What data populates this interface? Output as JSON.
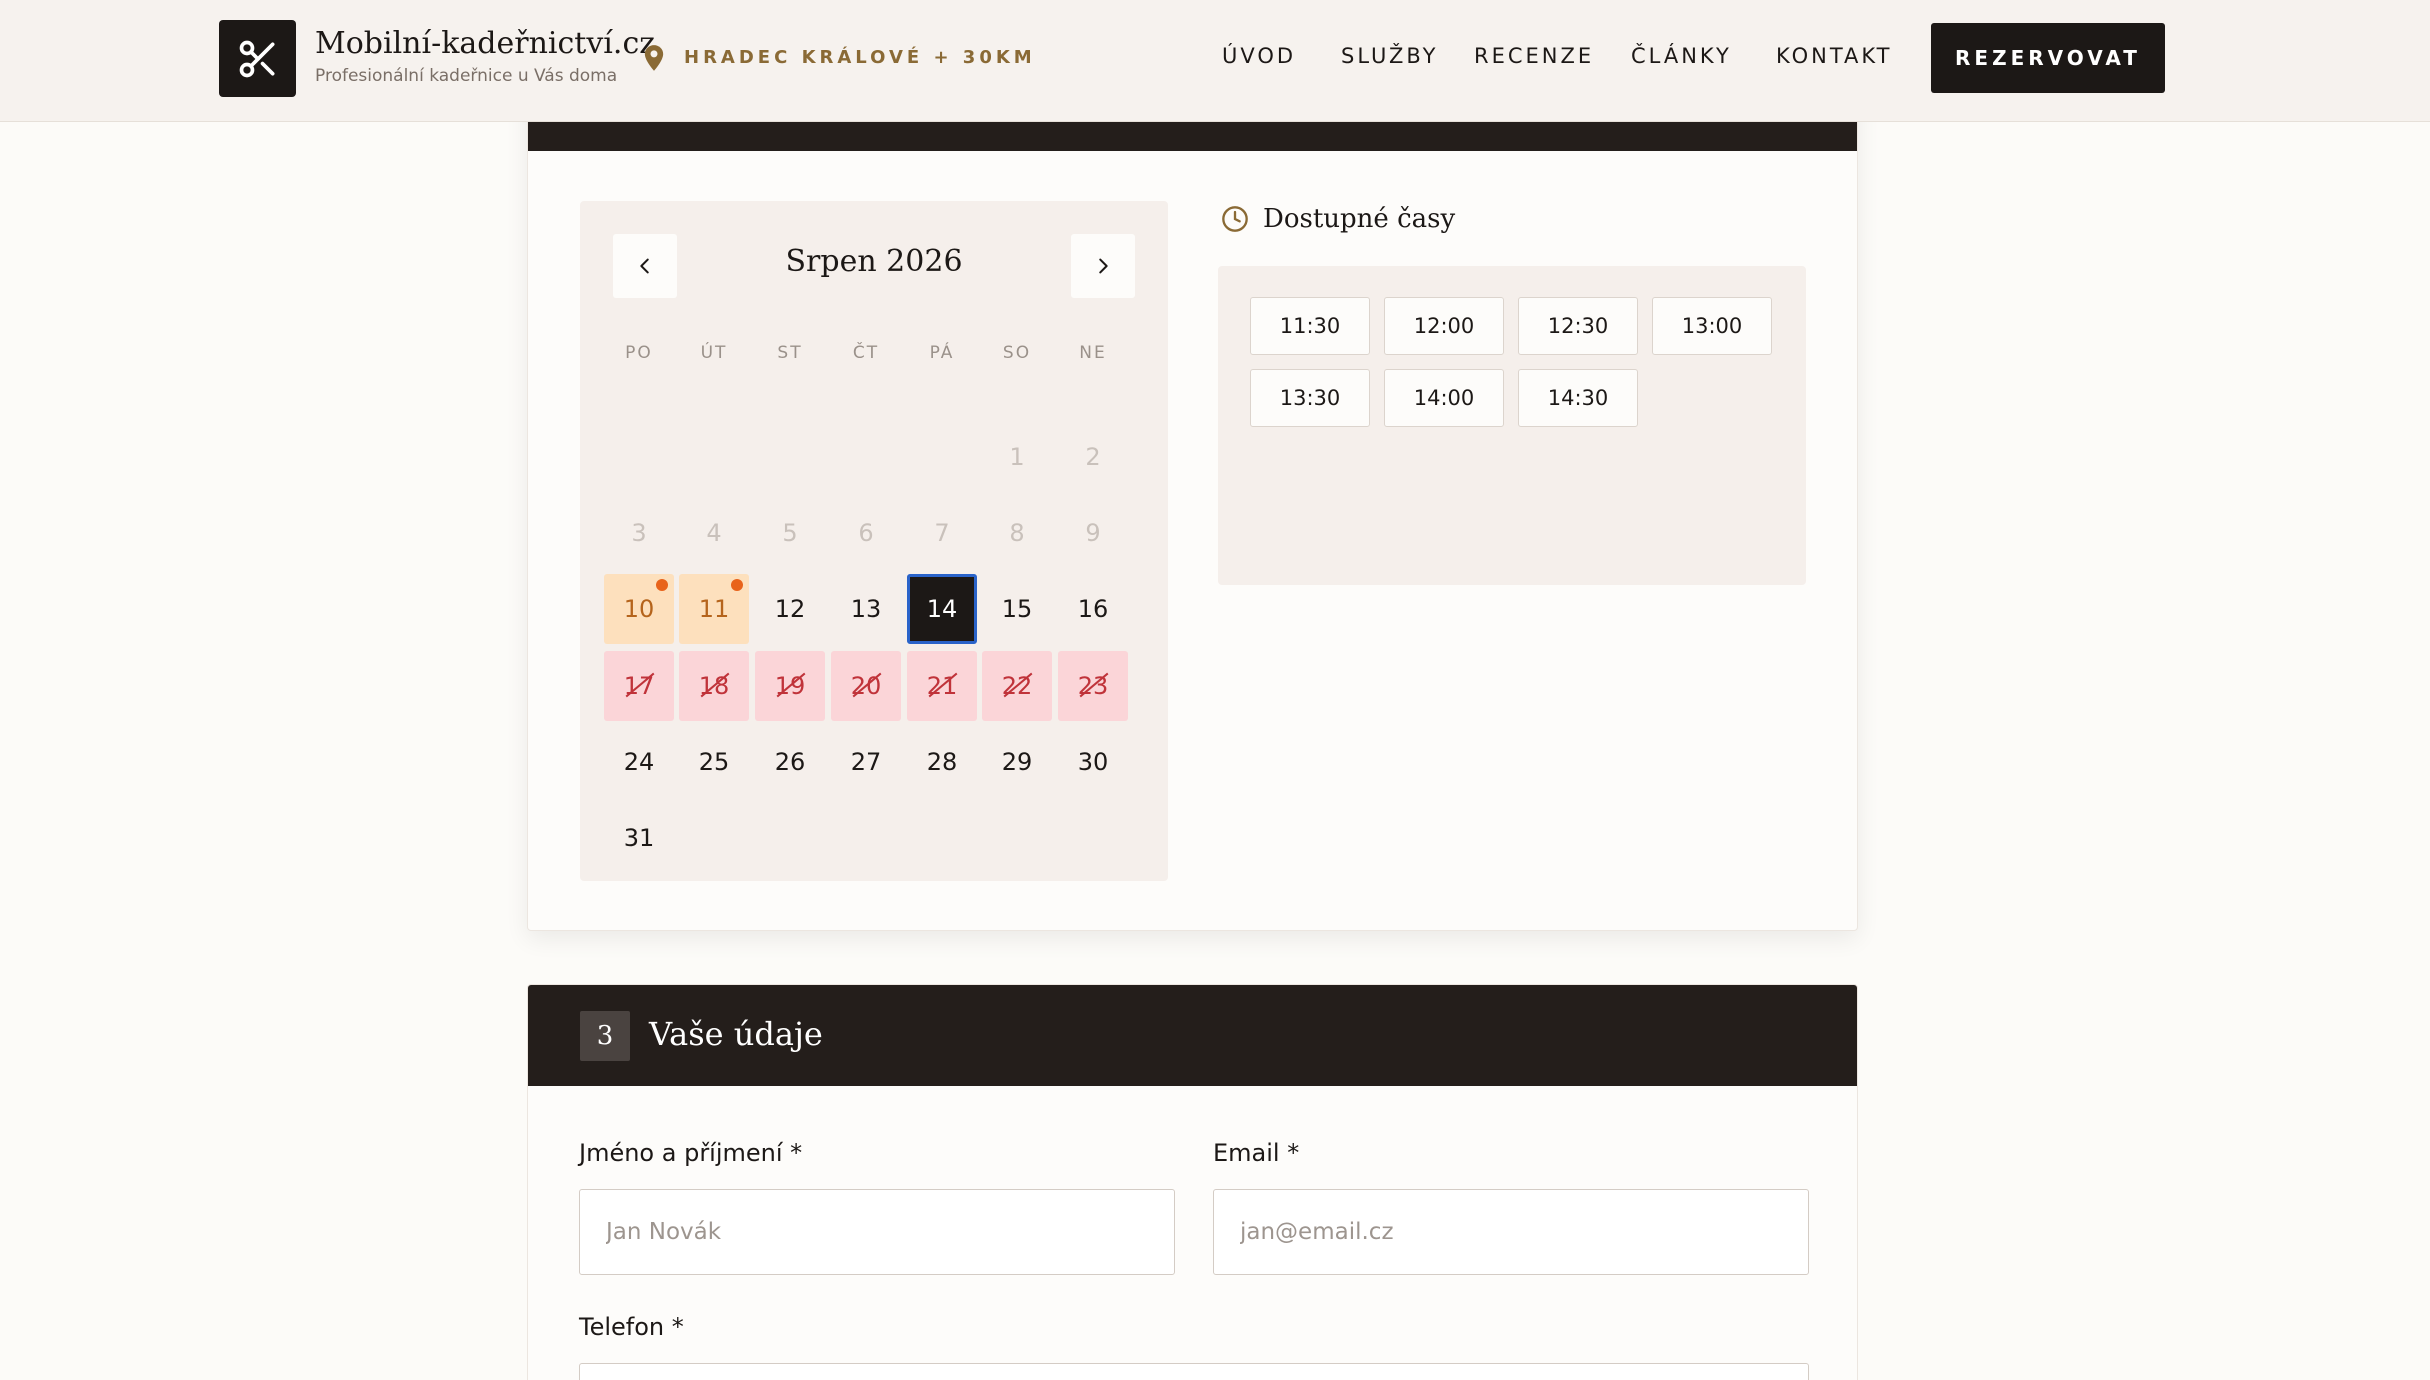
{
  "header": {
    "brand_name": "Mobilní-kadeřnictví.cz",
    "brand_sub": "Profesionální kadeřnice u Vás doma",
    "location": "HRADEC KRÁLOVÉ + 30KM",
    "nav": [
      "ÚVOD",
      "SLUŽBY",
      "RECENZE",
      "ČLÁNKY",
      "KONTAKT"
    ],
    "reserve_label": "REZERVOVAT"
  },
  "calendar": {
    "month_label": "Srpen 2026",
    "weekdays": [
      "PO",
      "ÚT",
      "ST",
      "ČT",
      "PÁ",
      "SO",
      "NE"
    ],
    "days": [
      {
        "n": "1",
        "state": "past"
      },
      {
        "n": "2",
        "state": "past"
      },
      {
        "n": "3",
        "state": "past"
      },
      {
        "n": "4",
        "state": "past"
      },
      {
        "n": "5",
        "state": "past"
      },
      {
        "n": "6",
        "state": "past"
      },
      {
        "n": "7",
        "state": "past"
      },
      {
        "n": "8",
        "state": "past"
      },
      {
        "n": "9",
        "state": "past"
      },
      {
        "n": "10",
        "state": "low"
      },
      {
        "n": "11",
        "state": "low"
      },
      {
        "n": "12",
        "state": "avail"
      },
      {
        "n": "13",
        "state": "avail"
      },
      {
        "n": "14",
        "state": "selected"
      },
      {
        "n": "15",
        "state": "avail"
      },
      {
        "n": "16",
        "state": "avail"
      },
      {
        "n": "17",
        "state": "full"
      },
      {
        "n": "18",
        "state": "full"
      },
      {
        "n": "19",
        "state": "full"
      },
      {
        "n": "20",
        "state": "full"
      },
      {
        "n": "21",
        "state": "full"
      },
      {
        "n": "22",
        "state": "full"
      },
      {
        "n": "23",
        "state": "full"
      },
      {
        "n": "24",
        "state": "avail"
      },
      {
        "n": "25",
        "state": "avail"
      },
      {
        "n": "26",
        "state": "avail"
      },
      {
        "n": "27",
        "state": "avail"
      },
      {
        "n": "28",
        "state": "avail"
      },
      {
        "n": "29",
        "state": "avail"
      },
      {
        "n": "30",
        "state": "avail"
      },
      {
        "n": "31",
        "state": "avail"
      }
    ]
  },
  "times": {
    "title": "Dostupné časy",
    "slots": [
      "11:30",
      "12:00",
      "12:30",
      "13:00",
      "13:30",
      "14:00",
      "14:30"
    ]
  },
  "details": {
    "step": "3",
    "title": "Vaše údaje",
    "name_label": "Jméno a příjmení *",
    "name_placeholder": "Jan Novák",
    "email_label": "Email *",
    "email_placeholder": "jan@email.cz",
    "phone_label": "Telefon *"
  },
  "colors": {
    "dark": "#1c1816",
    "accent_gold": "#8a6a35",
    "low_availability": "#fde0bd",
    "fully_booked": "#fbd5d8",
    "selected_border": "#2a63c9"
  }
}
